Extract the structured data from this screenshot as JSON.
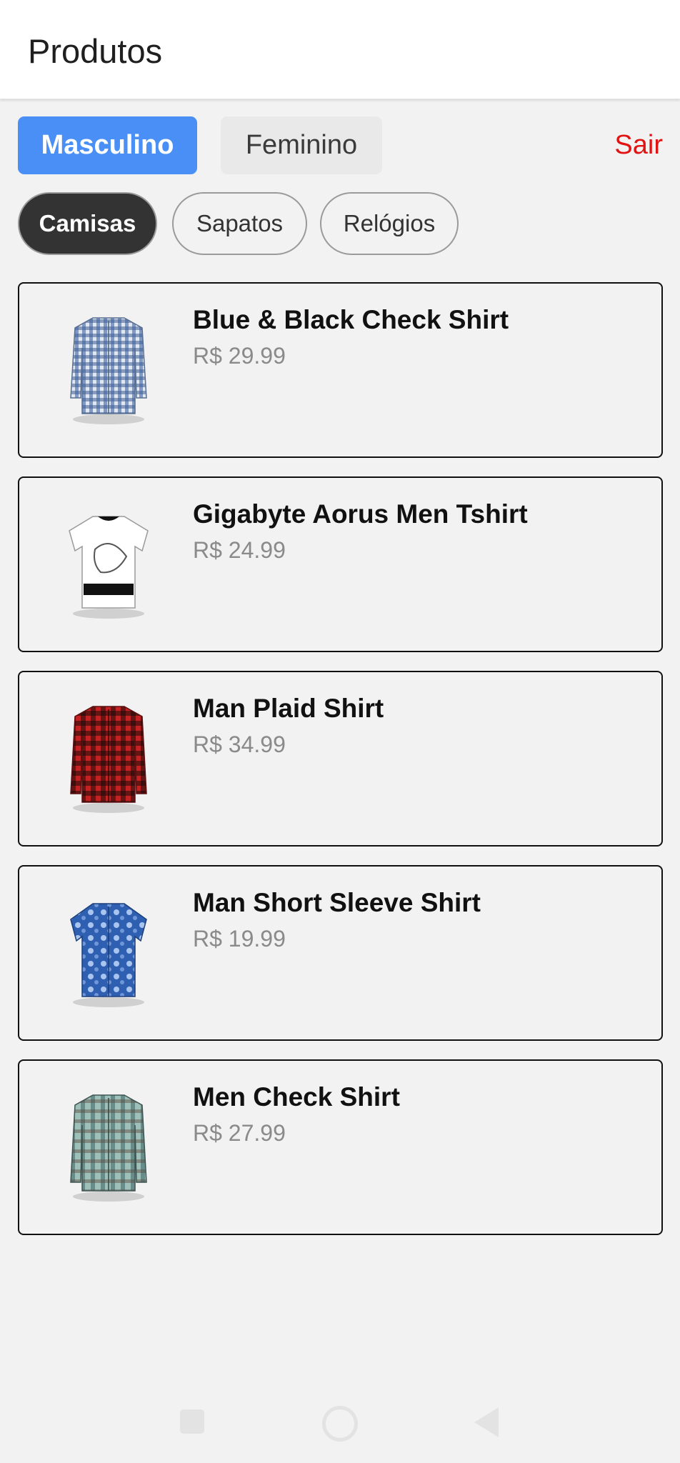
{
  "header": {
    "title": "Produtos"
  },
  "gender_tabs": [
    {
      "label": "Masculino",
      "selected": true
    },
    {
      "label": "Feminino",
      "selected": false
    }
  ],
  "logout_label": "Sair",
  "category_chips": [
    {
      "label": "Camisas",
      "selected": true
    },
    {
      "label": "Sapatos",
      "selected": false
    },
    {
      "label": "Relógios",
      "selected": false
    }
  ],
  "products": [
    {
      "name": "Blue & Black Check Shirt",
      "price": "R$ 29.99",
      "icon": "blue-check-shirt-image"
    },
    {
      "name": "Gigabyte Aorus Men Tshirt",
      "price": "R$ 24.99",
      "icon": "white-tshirt-image"
    },
    {
      "name": "Man Plaid Shirt",
      "price": "R$ 34.99",
      "icon": "red-plaid-shirt-image"
    },
    {
      "name": "Man Short Sleeve Shirt",
      "price": "R$ 19.99",
      "icon": "blue-floral-shirt-image"
    },
    {
      "name": "Men Check Shirt",
      "price": "R$ 27.99",
      "icon": "green-check-shirt-image"
    }
  ],
  "colors": {
    "accent": "#4a8ff5",
    "logout": "#e11313",
    "chip_selected": "#333333"
  }
}
